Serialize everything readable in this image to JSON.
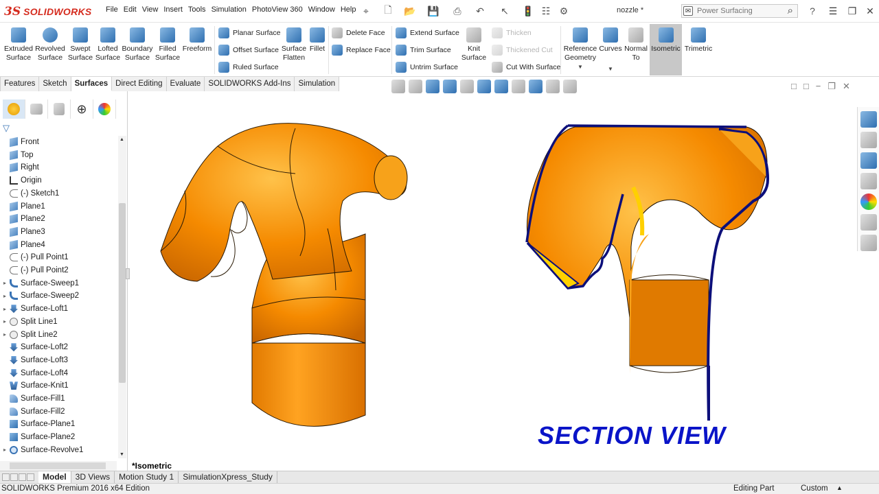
{
  "app": {
    "logo_text": "SOLIDWORKS",
    "document_title": "nozzle *"
  },
  "menu": [
    "File",
    "Edit",
    "View",
    "Insert",
    "Tools",
    "Simulation",
    "PhotoView 360",
    "Window",
    "Help"
  ],
  "search": {
    "placeholder": "Power Surfacing"
  },
  "ribbon": {
    "extruded": "Extruded Surface",
    "revolved": "Revolved Surface",
    "swept": "Swept Surface",
    "lofted": "Lofted Surface",
    "boundary": "Boundary Surface",
    "filled": "Filled Surface",
    "freeform": "Freeform",
    "planar": "Planar Surface",
    "offset": "Offset Surface",
    "ruled": "Ruled Surface",
    "flatten": "Surface Flatten",
    "fillet": "Fillet",
    "delete_face": "Delete Face",
    "replace_face": "Replace Face",
    "extend": "Extend Surface",
    "trim": "Trim Surface",
    "untrim": "Untrim Surface",
    "knit": "Knit Surface",
    "thicken": "Thicken",
    "thickened_cut": "Thickened Cut",
    "cut_with_surface": "Cut With Surface",
    "reference_geometry": "Reference Geometry",
    "curves": "Curves",
    "normal_to": "Normal To",
    "isometric": "Isometric",
    "trimetric": "Trimetric"
  },
  "command_tabs": [
    "Features",
    "Sketch",
    "Surfaces",
    "Direct Editing",
    "Evaluate",
    "SOLIDWORKS Add-Ins",
    "Simulation"
  ],
  "active_command_tab": "Surfaces",
  "tree": {
    "items": [
      {
        "label": "Front",
        "icon": "plane-icon",
        "expandable": false
      },
      {
        "label": "Top",
        "icon": "plane-icon",
        "expandable": false
      },
      {
        "label": "Right",
        "icon": "plane-icon",
        "expandable": false
      },
      {
        "label": "Origin",
        "icon": "origin-icon",
        "expandable": false
      },
      {
        "label": "(-) Sketch1",
        "icon": "sketch-icon",
        "expandable": false
      },
      {
        "label": "Plane1",
        "icon": "plane-icon",
        "expandable": false
      },
      {
        "label": "Plane2",
        "icon": "plane-icon",
        "expandable": false
      },
      {
        "label": "Plane3",
        "icon": "plane-icon",
        "expandable": false
      },
      {
        "label": "Plane4",
        "icon": "plane-icon",
        "expandable": false
      },
      {
        "label": "(-) Pull Point1",
        "icon": "sketch-icon",
        "expandable": false
      },
      {
        "label": "(-) Pull Point2",
        "icon": "sketch-icon",
        "expandable": false
      },
      {
        "label": "Surface-Sweep1",
        "icon": "sweep-icon",
        "expandable": true
      },
      {
        "label": "Surface-Sweep2",
        "icon": "sweep-icon",
        "expandable": true
      },
      {
        "label": "Surface-Loft1",
        "icon": "loft-icon",
        "expandable": true
      },
      {
        "label": "Split Line1",
        "icon": "split-line-icon",
        "expandable": true
      },
      {
        "label": "Split Line2",
        "icon": "split-line-icon",
        "expandable": true
      },
      {
        "label": "Surface-Loft2",
        "icon": "loft-icon",
        "expandable": false
      },
      {
        "label": "Surface-Loft3",
        "icon": "loft-icon",
        "expandable": false
      },
      {
        "label": "Surface-Loft4",
        "icon": "loft-icon",
        "expandable": false
      },
      {
        "label": "Surface-Knit1",
        "icon": "knit-icon",
        "expandable": false
      },
      {
        "label": "Surface-Fill1",
        "icon": "fill-icon",
        "expandable": false
      },
      {
        "label": "Surface-Fill2",
        "icon": "fill-icon",
        "expandable": false
      },
      {
        "label": "Surface-Plane1",
        "icon": "planar-icon",
        "expandable": false
      },
      {
        "label": "Surface-Plane2",
        "icon": "planar-icon",
        "expandable": false
      },
      {
        "label": "Surface-Revolve1",
        "icon": "revolve-icon",
        "expandable": true
      }
    ]
  },
  "viewport": {
    "view_label": "*Isometric",
    "section_caption": "SECTION VIEW",
    "model_color": "#f28a00",
    "section_edge_color": "#0c0f7a"
  },
  "bottom_tabs": [
    "Model",
    "3D Views",
    "Motion Study 1",
    "SimulationXpress_Study"
  ],
  "active_bottom_tab": "Model",
  "status": {
    "edition": "SOLIDWORKS Premium 2016 x64 Edition",
    "mode": "Editing Part",
    "units": "Custom"
  }
}
